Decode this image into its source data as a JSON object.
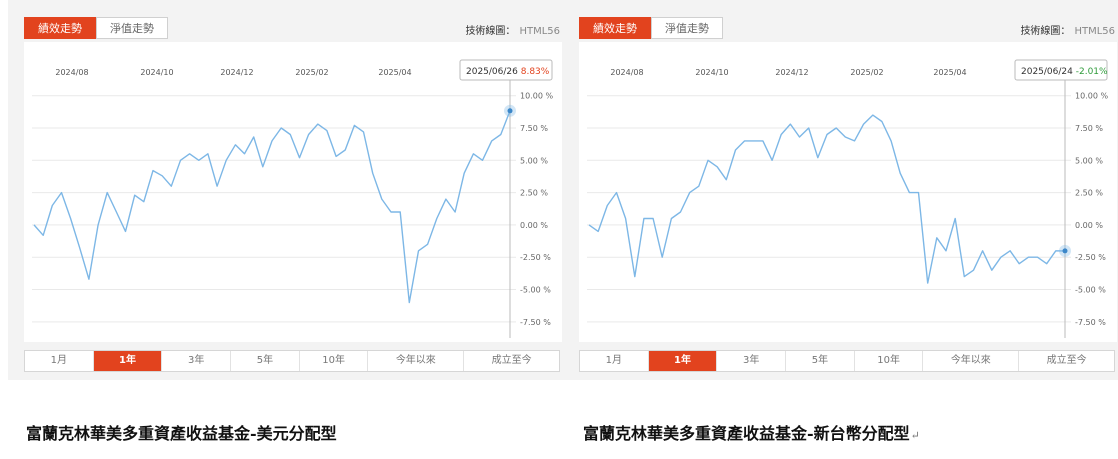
{
  "panels": [
    {
      "tabs": [
        {
          "label": "績效走勢",
          "active": true
        },
        {
          "label": "淨值走勢",
          "active": false
        }
      ],
      "tech_label": "技術線圖：",
      "tech_brand": "HTML56",
      "tooltip": {
        "date": "2025/06/26",
        "value": "8.83%",
        "color": "#e2431e"
      },
      "ranges": [
        "1月",
        "1年",
        "3年",
        "5年",
        "10年",
        "今年以來",
        "成立至今"
      ],
      "active_range": "1年",
      "caption": "富蘭克林華美多重資產收益基金-美元分配型",
      "caption_mark": ""
    },
    {
      "tabs": [
        {
          "label": "績效走勢",
          "active": true
        },
        {
          "label": "淨值走勢",
          "active": false
        }
      ],
      "tech_label": "技術線圖：",
      "tech_brand": "HTML56",
      "tooltip": {
        "date": "2025/06/24",
        "value": "-2.01%",
        "color": "#2e9b3a"
      },
      "ranges": [
        "1月",
        "1年",
        "3年",
        "5年",
        "10年",
        "今年以來",
        "成立至今"
      ],
      "active_range": "1年",
      "caption": "富蘭克林華美多重資產收益基金-新台幣分配型",
      "caption_mark": "↵"
    }
  ],
  "colors": {
    "accent": "#e2431e",
    "line": "#7db7e6",
    "grid": "#e9e9e9"
  },
  "chart_data": [
    {
      "type": "line",
      "x_tick_labels": [
        "2024/08",
        "2024/10",
        "2024/12",
        "2025/02",
        "2025/04"
      ],
      "y_tick_labels": [
        "10.00 %",
        "7.50 %",
        "5.00 %",
        "2.50 %",
        "0.00 %",
        "-2.50 %",
        "-5.00 %",
        "-7.50 %"
      ],
      "ylim": [
        -8.75,
        10.75
      ],
      "grid": true,
      "series": [
        {
          "x": [
            "2024/06",
            "2024/07/01",
            "2024/07/08",
            "2024/07/15",
            "2024/07/22",
            "2024/07/29",
            "2024/08/05",
            "2024/08/12",
            "2024/08/19",
            "2024/08/26",
            "2024/09/02",
            "2024/09/09",
            "2024/09/16",
            "2024/09/23",
            "2024/09/30",
            "2024/10/07",
            "2024/10/14",
            "2024/10/21",
            "2024/10/28",
            "2024/11/04",
            "2024/11/11",
            "2024/11/18",
            "2024/11/25",
            "2024/12/02",
            "2024/12/09",
            "2024/12/16",
            "2024/12/23",
            "2024/12/30",
            "2025/01/06",
            "2025/01/13",
            "2025/01/20",
            "2025/01/27",
            "2025/02/03",
            "2025/02/10",
            "2025/02/17",
            "2025/02/24",
            "2025/03/03",
            "2025/03/10",
            "2025/03/17",
            "2025/03/24",
            "2025/03/31",
            "2025/04/07",
            "2025/04/14",
            "2025/04/21",
            "2025/04/28",
            "2025/05/05",
            "2025/05/12",
            "2025/05/19",
            "2025/05/26",
            "2025/06/02",
            "2025/06/09",
            "2025/06/16",
            "2025/06/26"
          ],
          "values": [
            0.0,
            -0.8,
            1.5,
            2.5,
            0.5,
            -1.8,
            -4.2,
            0.0,
            2.5,
            1.0,
            -0.5,
            2.3,
            1.8,
            4.2,
            3.8,
            3.0,
            5.0,
            5.5,
            5.0,
            5.5,
            3.0,
            5.0,
            6.2,
            5.5,
            6.8,
            4.5,
            6.5,
            7.5,
            7.0,
            5.2,
            7.0,
            7.8,
            7.3,
            5.3,
            5.8,
            7.7,
            7.2,
            4.0,
            2.0,
            1.0,
            1.0,
            -6.0,
            -2.0,
            -1.5,
            0.5,
            2.0,
            1.0,
            4.0,
            5.5,
            5.0,
            6.5,
            7.0,
            8.83
          ]
        }
      ]
    },
    {
      "type": "line",
      "x_tick_labels": [
        "2024/08",
        "2024/10",
        "2024/12",
        "2025/02",
        "2025/04"
      ],
      "y_tick_labels": [
        "10.00 %",
        "7.50 %",
        "5.00 %",
        "2.50 %",
        "0.00 %",
        "-2.50 %",
        "-5.00 %",
        "-7.50 %"
      ],
      "ylim": [
        -8.75,
        10.75
      ],
      "grid": true,
      "series": [
        {
          "x": [
            "2024/06",
            "2024/07/01",
            "2024/07/08",
            "2024/07/15",
            "2024/07/22",
            "2024/07/29",
            "2024/08/05",
            "2024/08/12",
            "2024/08/19",
            "2024/08/26",
            "2024/09/02",
            "2024/09/09",
            "2024/09/16",
            "2024/09/23",
            "2024/09/30",
            "2024/10/07",
            "2024/10/14",
            "2024/10/21",
            "2024/10/28",
            "2024/11/04",
            "2024/11/11",
            "2024/11/18",
            "2024/11/25",
            "2024/12/02",
            "2024/12/09",
            "2024/12/16",
            "2024/12/23",
            "2024/12/30",
            "2025/01/06",
            "2025/01/13",
            "2025/01/20",
            "2025/01/27",
            "2025/02/03",
            "2025/02/10",
            "2025/02/17",
            "2025/02/24",
            "2025/03/03",
            "2025/03/10",
            "2025/03/17",
            "2025/03/24",
            "2025/03/31",
            "2025/04/07",
            "2025/04/14",
            "2025/04/21",
            "2025/04/28",
            "2025/05/05",
            "2025/05/12",
            "2025/05/19",
            "2025/05/26",
            "2025/06/02",
            "2025/06/09",
            "2025/06/16",
            "2025/06/24"
          ],
          "values": [
            0.0,
            -0.5,
            1.5,
            2.5,
            0.5,
            -4.0,
            0.5,
            0.5,
            -2.5,
            0.5,
            1.0,
            2.5,
            3.0,
            5.0,
            4.5,
            3.5,
            5.8,
            6.5,
            6.5,
            6.5,
            5.0,
            7.0,
            7.8,
            6.8,
            7.5,
            5.2,
            7.0,
            7.5,
            6.8,
            6.5,
            7.8,
            8.5,
            8.0,
            6.5,
            4.0,
            2.5,
            2.5,
            -4.5,
            -1.0,
            -2.0,
            0.5,
            -4.0,
            -3.5,
            -2.0,
            -3.5,
            -2.5,
            -2.0,
            -3.0,
            -2.5,
            -2.5,
            -3.0,
            -2.0,
            -2.01
          ]
        }
      ]
    }
  ]
}
